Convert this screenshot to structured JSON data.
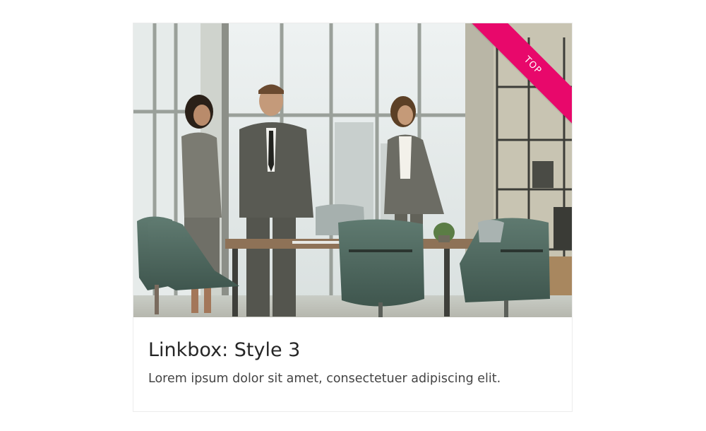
{
  "linkbox": {
    "title": "Linkbox: Style 3",
    "description": "Lorem ipsum dolor sit amet, consectetuer adipiscing elit.",
    "ribbon_label": "TOP",
    "ribbon_color": "#e8086b",
    "image_alt": "Three business people in suits standing in a bright office meeting room with green chairs and a table"
  }
}
